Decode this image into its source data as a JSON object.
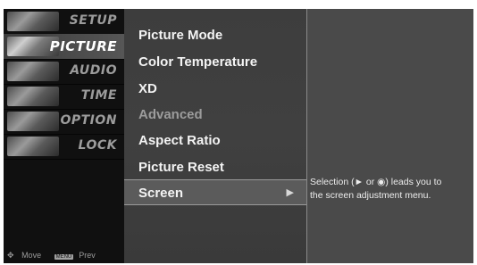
{
  "categories": [
    {
      "label": "SETUP",
      "icon": "setup-thumbnail-icon",
      "active": false
    },
    {
      "label": "PICTURE",
      "icon": "picture-thumbnail-icon",
      "active": true
    },
    {
      "label": "AUDIO",
      "icon": "audio-thumbnail-icon",
      "active": false
    },
    {
      "label": "TIME",
      "icon": "time-thumbnail-icon",
      "active": false
    },
    {
      "label": "OPTION",
      "icon": "option-thumbnail-icon",
      "active": false
    },
    {
      "label": "LOCK",
      "icon": "lock-thumbnail-icon",
      "active": false
    }
  ],
  "nav_hint": {
    "move_label": "Move",
    "menu_key": "MENU",
    "prev_label": "Prev"
  },
  "options": [
    {
      "label": "Picture Mode",
      "enabled": true
    },
    {
      "label": "Color Temperature",
      "enabled": true
    },
    {
      "label": "XD",
      "enabled": true
    },
    {
      "label": "Advanced",
      "enabled": false
    },
    {
      "label": "Aspect Ratio",
      "enabled": true
    },
    {
      "label": "Picture Reset",
      "enabled": true
    },
    {
      "label": "Screen",
      "enabled": true,
      "selected": true,
      "has_submenu": true
    }
  ],
  "help": {
    "text": "Selection (► or ◉) leads you to\nthe screen adjustment menu."
  },
  "colors": {
    "background": "#2a2a2a",
    "text": "#f4f4f4",
    "disabled_text": "#9c9c9c",
    "selected_bg": "#5b5b5b"
  }
}
